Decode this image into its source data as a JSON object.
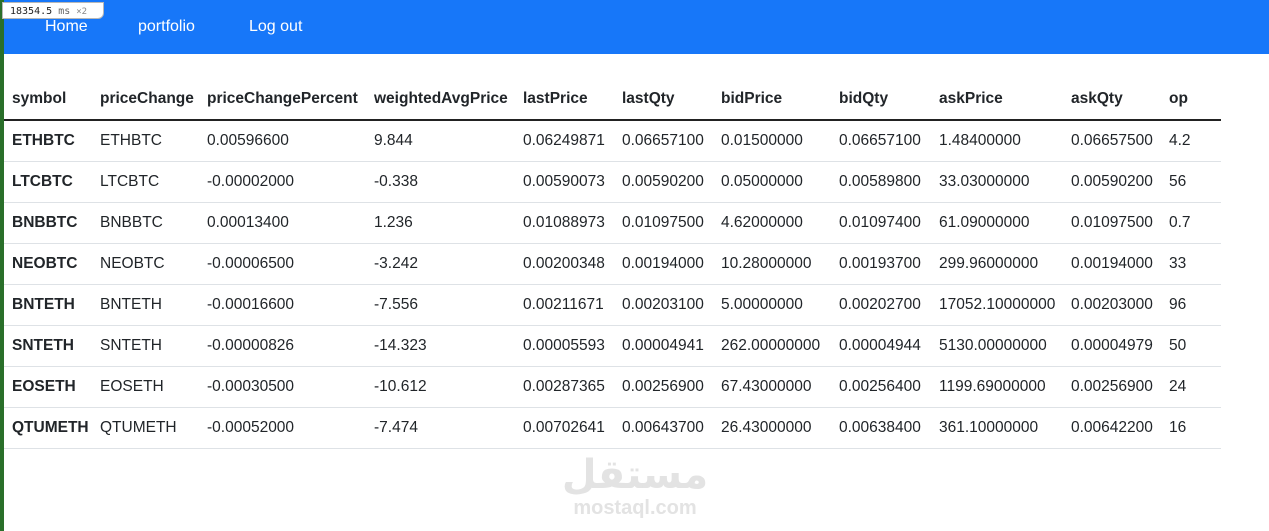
{
  "debug": {
    "timing": "18354.5",
    "unit": "ms",
    "multiplier": "×2"
  },
  "nav": {
    "home": "Home",
    "portfolio": "portfolio",
    "logout": "Log out"
  },
  "table": {
    "headers": [
      "symbol",
      "priceChange",
      "priceChangePercent",
      "weightedAvgPrice",
      "lastPrice",
      "lastQty",
      "bidPrice",
      "bidQty",
      "askPrice",
      "askQty",
      "op"
    ],
    "rows": [
      [
        "ETHBTC",
        "ETHBTC",
        "0.00596600",
        "9.844",
        "0.06249871",
        "0.06657100",
        "0.01500000",
        "0.06657100",
        "1.48400000",
        "0.06657500",
        "4.2"
      ],
      [
        "LTCBTC",
        "LTCBTC",
        "-0.00002000",
        "-0.338",
        "0.00590073",
        "0.00590200",
        "0.05000000",
        "0.00589800",
        "33.03000000",
        "0.00590200",
        "56"
      ],
      [
        "BNBBTC",
        "BNBBTC",
        "0.00013400",
        "1.236",
        "0.01088973",
        "0.01097500",
        "4.62000000",
        "0.01097400",
        "61.09000000",
        "0.01097500",
        "0.7"
      ],
      [
        "NEOBTC",
        "NEOBTC",
        "-0.00006500",
        "-3.242",
        "0.00200348",
        "0.00194000",
        "10.28000000",
        "0.00193700",
        "299.96000000",
        "0.00194000",
        "33"
      ],
      [
        "BNTETH",
        "BNTETH",
        "-0.00016600",
        "-7.556",
        "0.00211671",
        "0.00203100",
        "5.00000000",
        "0.00202700",
        "17052.10000000",
        "0.00203000",
        "96"
      ],
      [
        "SNTETH",
        "SNTETH",
        "-0.00000826",
        "-14.323",
        "0.00005593",
        "0.00004941",
        "262.00000000",
        "0.00004944",
        "5130.00000000",
        "0.00004979",
        "50"
      ],
      [
        "EOSETH",
        "EOSETH",
        "-0.00030500",
        "-10.612",
        "0.00287365",
        "0.00256900",
        "67.43000000",
        "0.00256400",
        "1199.69000000",
        "0.00256900",
        "24"
      ],
      [
        "QTUMETH",
        "QTUMETH",
        "-0.00052000",
        "-7.474",
        "0.00702641",
        "0.00643700",
        "26.43000000",
        "0.00638400",
        "361.10000000",
        "0.00642200",
        "16"
      ]
    ]
  },
  "watermark": {
    "arabic": "مستقل",
    "latin": "mostaql.com"
  },
  "colors": {
    "navbar": "#1777f9",
    "text": "#212529",
    "watermark": "#e3e3e3"
  }
}
